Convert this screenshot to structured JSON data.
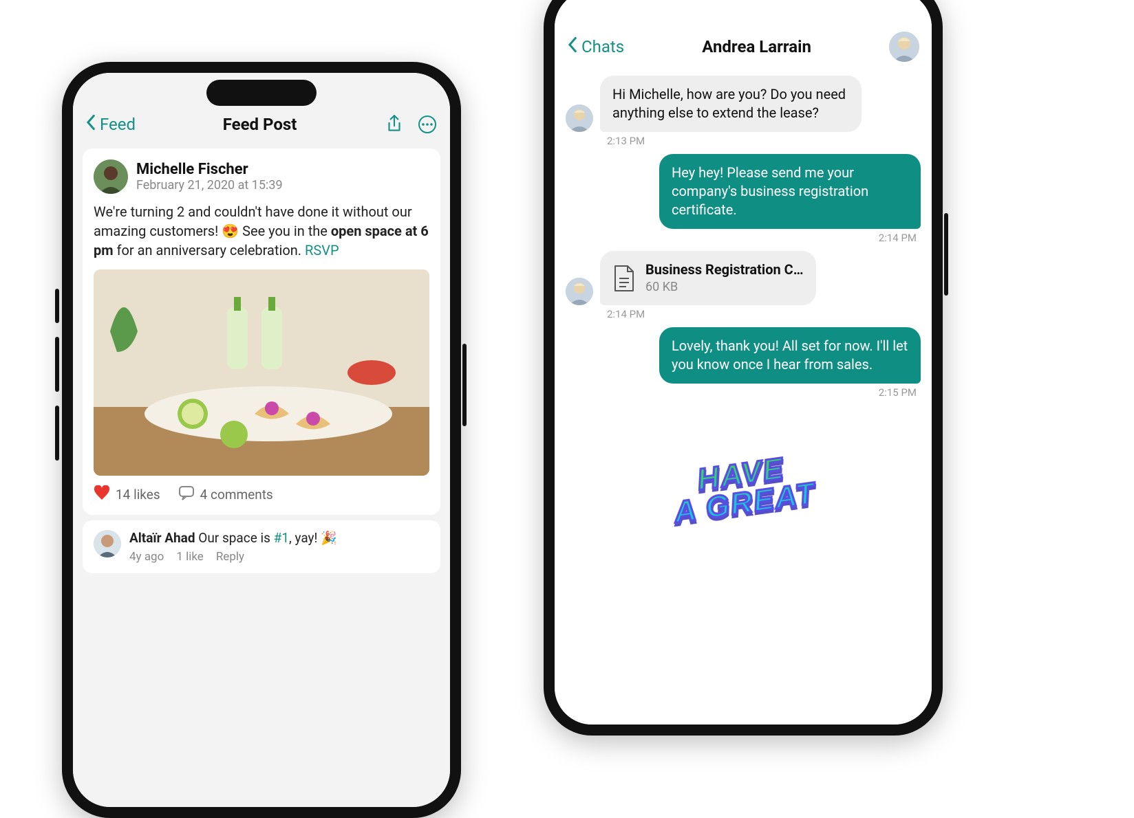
{
  "colors": {
    "accent": "#139186",
    "bubbleOut": "#0f8e83",
    "heart": "#e8362f"
  },
  "left": {
    "nav": {
      "back": "Feed",
      "title": "Feed Post"
    },
    "post": {
      "author": "Michelle Fischer",
      "date": "February 21, 2020 at 15:39",
      "body_pre": "We're turning 2 and couldn't have done it without our amazing customers! ",
      "emoji": "😍",
      "body_mid": " See you in the ",
      "bold": "open space at 6 pm",
      "body_post": " for an anniversary celebration. ",
      "link": "RSVP",
      "image_alt": "tacos-and-drinks-photo",
      "likes": "14 likes",
      "comments": "4 comments"
    },
    "comment": {
      "author": "Altaïr Ahad",
      "text_pre": " Our space is ",
      "link": "#1",
      "text_post": ", yay! ",
      "emoji": "🎉",
      "meta_time": "4y ago",
      "meta_likes": "1 like",
      "meta_reply": "Reply"
    }
  },
  "right": {
    "nav": {
      "back": "Chats",
      "title": "Andrea Larrain"
    },
    "messages": [
      {
        "side": "in",
        "text": "Hi Michelle, how are you? Do you need anything else to extend the lease?",
        "ts": "2:13 PM",
        "avatar": true
      },
      {
        "side": "out",
        "text": "Hey hey! Please send me your company's business registration certificate.",
        "ts": "2:14 PM"
      },
      {
        "side": "in",
        "file_name": "Business Registration C…",
        "file_size": "60 KB",
        "ts": "2:14 PM",
        "avatar": true
      },
      {
        "side": "out",
        "text": "Lovely, thank you! All set for now. I'll let you know once I hear from sales.",
        "ts": "2:15 PM"
      }
    ],
    "sticker_line1": "HAVE",
    "sticker_line2": "A GREAT"
  }
}
